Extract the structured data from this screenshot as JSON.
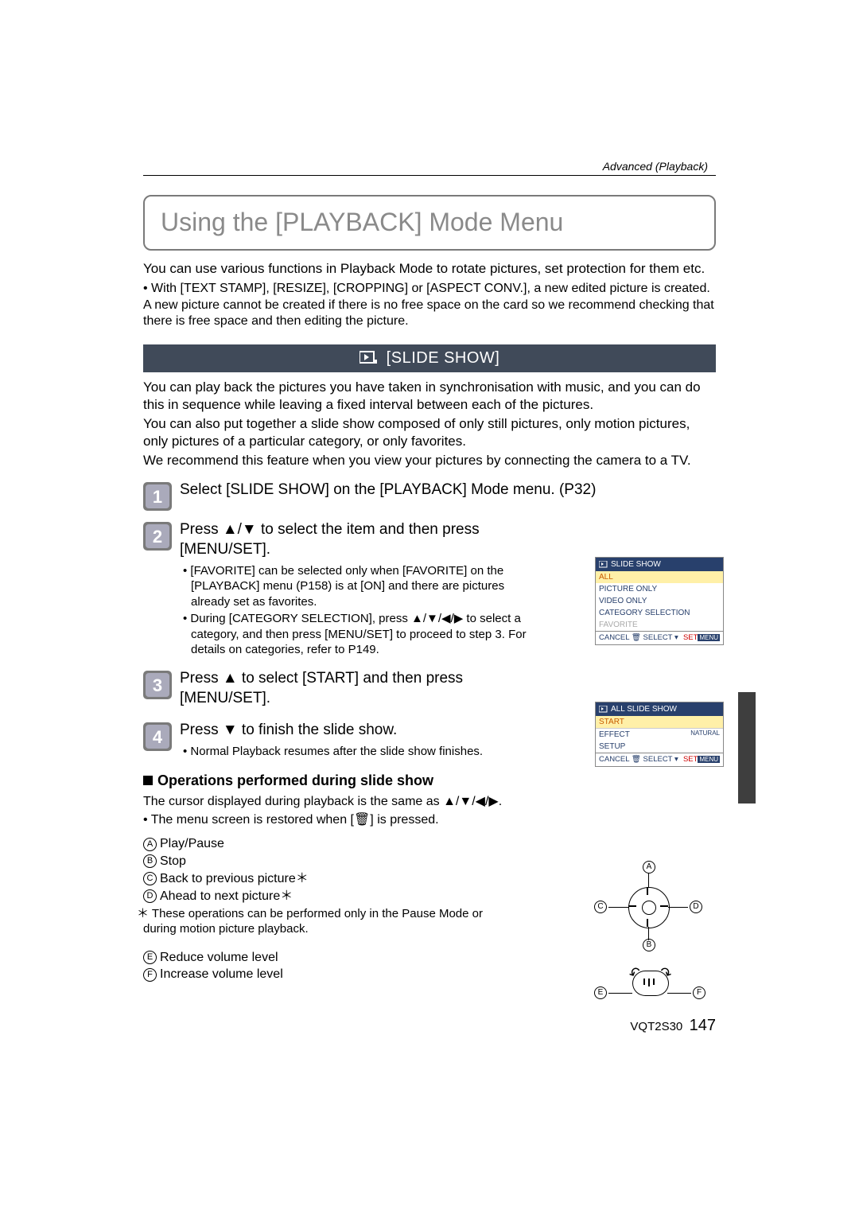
{
  "section_header": "Advanced (Playback)",
  "title": "Using the [PLAYBACK] Mode Menu",
  "intro": {
    "p1": "You can use various functions in Playback Mode to rotate pictures, set protection for them etc.",
    "bullet1": "• With [TEXT STAMP], [RESIZE], [CROPPING] or [ASPECT CONV.], a new edited picture is created. A new picture cannot be created if there is no free space on the card so we recommend checking that there is free space and then editing the picture."
  },
  "slide_bar": "[SLIDE SHOW]",
  "slide_desc": {
    "p1": "You can play back the pictures you have taken in synchronisation with music, and you can do this in sequence while leaving a fixed interval between each of the pictures.",
    "p2": "You can also put together a slide show composed of only still pictures, only motion pictures, only pictures of a particular category, or only favorites.",
    "p3": "We recommend this feature when you view your pictures by connecting the camera to a TV."
  },
  "steps": {
    "s1": "Select [SLIDE SHOW] on the [PLAYBACK] Mode menu. (P32)",
    "s2": "Press ▲/▼ to select the item and then press [MENU/SET].",
    "s2a": "• [FAVORITE] can be selected only when [FAVORITE] on the [PLAYBACK] menu (P158) is at [ON] and there are pictures already set as favorites.",
    "s2b": "• During [CATEGORY SELECTION], press ▲/▼/◀/▶ to select a category, and then press [MENU/SET] to proceed to step 3. For details on categories, refer to P149.",
    "s3": "Press ▲ to select [START] and then press [MENU/SET].",
    "s4": "Press ▼ to finish the slide show.",
    "s4a": "• Normal Playback resumes after the slide show finishes."
  },
  "ops_heading": "Operations performed during slide show",
  "ops": {
    "p1": "The cursor displayed during playback is the same as ▲/▼/◀/▶.",
    "p2": "• The menu screen is restored when [🗑] is pressed."
  },
  "ops_labels": {
    "A": "Play/Pause",
    "B": "Stop",
    "C": "Back to previous picture＊",
    "D": "Ahead to next picture＊",
    "star": "These operations can be performed only in the Pause Mode or during motion picture playback.",
    "E": "Reduce volume level",
    "F": "Increase volume level"
  },
  "mini1": {
    "header": "SLIDE SHOW",
    "r1": "ALL",
    "r2": "PICTURE ONLY",
    "r3": "VIDEO ONLY",
    "r4": "CATEGORY SELECTION",
    "r5": "FAVORITE",
    "footer_left": "CANCEL 🗑 SELECT ▾",
    "footer_right": "SET"
  },
  "mini2": {
    "header": "ALL SLIDE SHOW",
    "r1": "START",
    "r2": "EFFECT",
    "r2r": "NATURAL",
    "r3": "SETUP",
    "footer_left": "CANCEL 🗑 SELECT ▾",
    "footer_right": "SET"
  },
  "footer": {
    "code": "VQT2S30",
    "page": "147"
  }
}
